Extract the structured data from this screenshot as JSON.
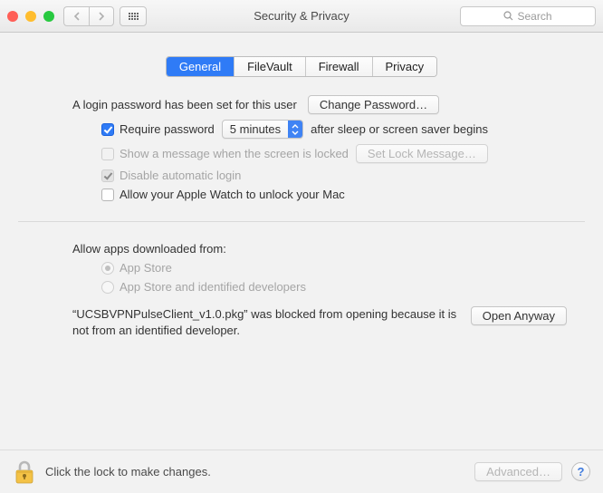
{
  "window": {
    "title": "Security & Privacy"
  },
  "search": {
    "placeholder": "Search"
  },
  "tabs": {
    "general": "General",
    "filevault": "FileVault",
    "firewall": "Firewall",
    "privacy": "Privacy"
  },
  "login": {
    "set_text": "A login password has been set for this user",
    "change_btn": "Change Password…",
    "require_label": "Require password",
    "delay_selected": "5 minutes",
    "after_sleep_label": "after sleep or screen saver begins",
    "show_message_label": "Show a message when the screen is locked",
    "set_lock_btn": "Set Lock Message…",
    "disable_auto_label": "Disable automatic login",
    "watch_label": "Allow your Apple Watch to unlock your Mac"
  },
  "downloads": {
    "heading": "Allow apps downloaded from:",
    "opt_appstore": "App Store",
    "opt_identified": "App Store and identified developers",
    "blocked_msg": "“UCSBVPNPulseClient_v1.0.pkg” was blocked from opening because it is not from an identified developer.",
    "open_anyway": "Open Anyway"
  },
  "footer": {
    "lock_text": "Click the lock to make changes.",
    "advanced": "Advanced…",
    "help": "?"
  }
}
